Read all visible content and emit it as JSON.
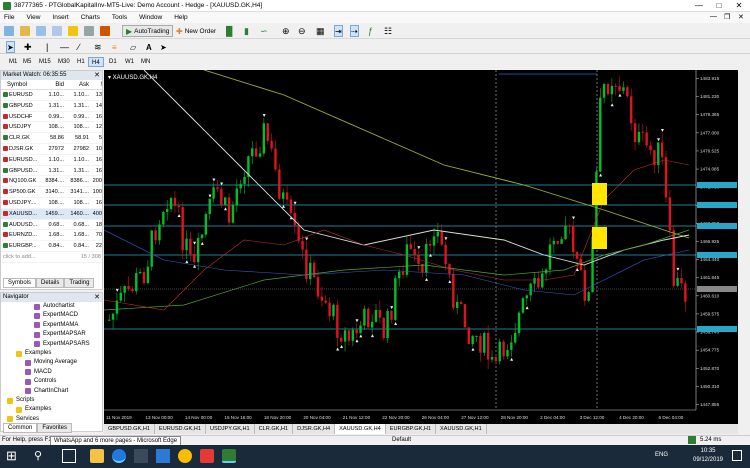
{
  "window": {
    "title": "38777365 - PTGlobalKapitalInv-MT5-Live: Demo Account - Hedge - [XAUUSD.GK,H4]"
  },
  "menu": [
    "File",
    "View",
    "Insert",
    "Charts",
    "Tools",
    "Window",
    "Help"
  ],
  "toolbar": {
    "autotrading": "AutoTrading",
    "new_order": "New Order"
  },
  "timeframes": [
    "M1",
    "M5",
    "M15",
    "M30",
    "H1",
    "H4",
    "D1",
    "W1",
    "MN"
  ],
  "selected_timeframe": "H4",
  "market_watch": {
    "title": "Market Watch: 06:35:55",
    "columns": [
      "Symbol",
      "Bid",
      "Ask",
      "!"
    ],
    "rows": [
      {
        "symbol": "EURUSD",
        "bid": "1.10...",
        "ask": "1.10...",
        "spread": "13",
        "color": "#2e7d32"
      },
      {
        "symbol": "GBPUSD",
        "bid": "1.31...",
        "ask": "1.31...",
        "spread": "14",
        "color": "#2e7d32"
      },
      {
        "symbol": "USDCHF",
        "bid": "0.99...",
        "ask": "0.99...",
        "spread": "16",
        "color": "#c62828"
      },
      {
        "symbol": "USDJPY",
        "bid": "108....",
        "ask": "108....",
        "spread": "12",
        "color": "#c62828"
      },
      {
        "symbol": "CLR.GK",
        "bid": "58.86",
        "ask": "58.91",
        "spread": "5",
        "color": "#2e7d32"
      },
      {
        "symbol": "DJSR.GK",
        "bid": "27972",
        "ask": "27982",
        "spread": "10",
        "color": "#c62828"
      },
      {
        "symbol": "EURUSD...",
        "bid": "1.10...",
        "ask": "1.10...",
        "spread": "16",
        "color": "#c62828"
      },
      {
        "symbol": "GBPUSD...",
        "bid": "1.31...",
        "ask": "1.31...",
        "spread": "16",
        "color": "#2e7d32"
      },
      {
        "symbol": "NQ100.GK",
        "bid": "8384....",
        "ask": "8386....",
        "spread": "200",
        "color": "#c62828"
      },
      {
        "symbol": "SP500.GK",
        "bid": "3140....",
        "ask": "3141....",
        "spread": "100",
        "color": "#c62828"
      },
      {
        "symbol": "USDJPY....",
        "bid": "108....",
        "ask": "108....",
        "spread": "16",
        "color": "#c62828"
      },
      {
        "symbol": "XAUUSD...",
        "bid": "1459....",
        "ask": "1460....",
        "spread": "400",
        "color": "#c62828"
      },
      {
        "symbol": "AUDUSD...",
        "bid": "0.68...",
        "ask": "0.68...",
        "spread": "18",
        "color": "#2e7d32"
      },
      {
        "symbol": "EURNZD...",
        "bid": "1.68...",
        "ask": "1.68...",
        "spread": "70",
        "color": "#c62828"
      },
      {
        "symbol": "EURGBP...",
        "bid": "0.84...",
        "ask": "0.84...",
        "spread": "22",
        "color": "#2e7d32"
      }
    ],
    "add_placeholder": "click to add...",
    "count": "15 / 308",
    "tabs": [
      "Symbols",
      "Details",
      "Trading"
    ]
  },
  "navigator": {
    "title": "Navigator",
    "items": [
      {
        "label": "Autochartist",
        "level": 3,
        "icon": "expert-icon"
      },
      {
        "label": "ExpertMACD",
        "level": 3,
        "icon": "expert-icon"
      },
      {
        "label": "ExpertMAMA",
        "level": 3,
        "icon": "expert-icon"
      },
      {
        "label": "ExpertMAPSAR",
        "level": 3,
        "icon": "expert-icon"
      },
      {
        "label": "ExpertMAPSARS",
        "level": 3,
        "icon": "expert-icon"
      },
      {
        "label": "Examples",
        "level": 1,
        "icon": "folder-icon"
      },
      {
        "label": "Moving Average",
        "level": 2,
        "icon": "expert-icon"
      },
      {
        "label": "MACD",
        "level": 2,
        "icon": "expert-icon"
      },
      {
        "label": "Controls",
        "level": 2,
        "icon": "expert-icon"
      },
      {
        "label": "ChartInChart",
        "level": 2,
        "icon": "expert-icon"
      },
      {
        "label": "Scripts",
        "level": 0,
        "icon": "folder-icon"
      },
      {
        "label": "Examples",
        "level": 1,
        "icon": "folder-icon"
      },
      {
        "label": "Services",
        "level": 0,
        "icon": "folder-icon"
      }
    ],
    "tabs": [
      "Common",
      "Favorites"
    ]
  },
  "chart": {
    "label": "XAUUSD.GK,H4",
    "price_labels": [
      "1483.915",
      "1481.230",
      "1479.365",
      "1477.000",
      "1476.525",
      "1474.085",
      "1471.730",
      "1470.015",
      "1468.250",
      "1466.925",
      "1464.440",
      "1461.845",
      "1460.610",
      "1459.575",
      "1456.740",
      "1454.775",
      "1452.870",
      "1450.310",
      "1447.855"
    ],
    "time_labels": [
      "11 Nov 2019",
      "13 Nov 00:00",
      "14 Nov 00:00",
      "15 Nov 16:00",
      "18 Nov 20:00",
      "20 Nov 04:00",
      "21 Nov 12:00",
      "22 Nov 20:00",
      "26 Nov 04:00",
      "27 Nov 12:00",
      "28 Nov 20:00",
      "2 Dec 04:00",
      "3 Dec 12:00",
      "4 Dec 20:00",
      "6 Dec 04:00"
    ]
  },
  "chart_tabs": [
    "GBPUSD.GK,H1",
    "EURUSD.GK,H1",
    "USDJPY.GK,H1",
    "CLR.GK,H1",
    "DJSR.GK,H4",
    "XAUUSD.GK,H4",
    "EURGBP.GK,H1",
    "XAUUSD.GK,H1"
  ],
  "active_chart_tab": "XAUUSD.GK,H4",
  "status": {
    "help": "For Help, press F1",
    "profile": "Default",
    "net": "5.24 ms"
  },
  "taskbar": {
    "tooltip": "WhatsApp and 6 more pages - Microsoft Edge",
    "time": "10:35",
    "date": "09/12/2019",
    "lang": "ENG"
  }
}
